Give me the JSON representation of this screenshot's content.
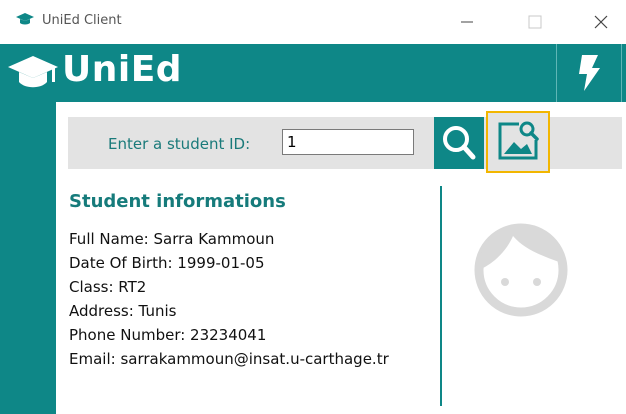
{
  "window": {
    "title": "UniEd Client"
  },
  "header": {
    "brand": "UniEd",
    "brand_icon": "graduation-cap-icon",
    "action_icon": "lightning-icon"
  },
  "search": {
    "label": "Enter a student ID:",
    "value": "1",
    "search_icon": "magnifier-icon",
    "photo_icon": "image-search-icon"
  },
  "student": {
    "section_title": "Student informations",
    "full_name": "Full Name: Sarra Kammoun",
    "date_of_birth": "Date Of Birth: 1999-01-05",
    "class": "Class: RT2",
    "address": "Address: Tunis",
    "phone": "Phone Number: 23234041",
    "email": "Email: sarrakammoun@insat.u-carthage.tr"
  },
  "colors": {
    "accent": "#0e8787",
    "highlight": "#f2b600",
    "panel": "#e3e3e3"
  }
}
